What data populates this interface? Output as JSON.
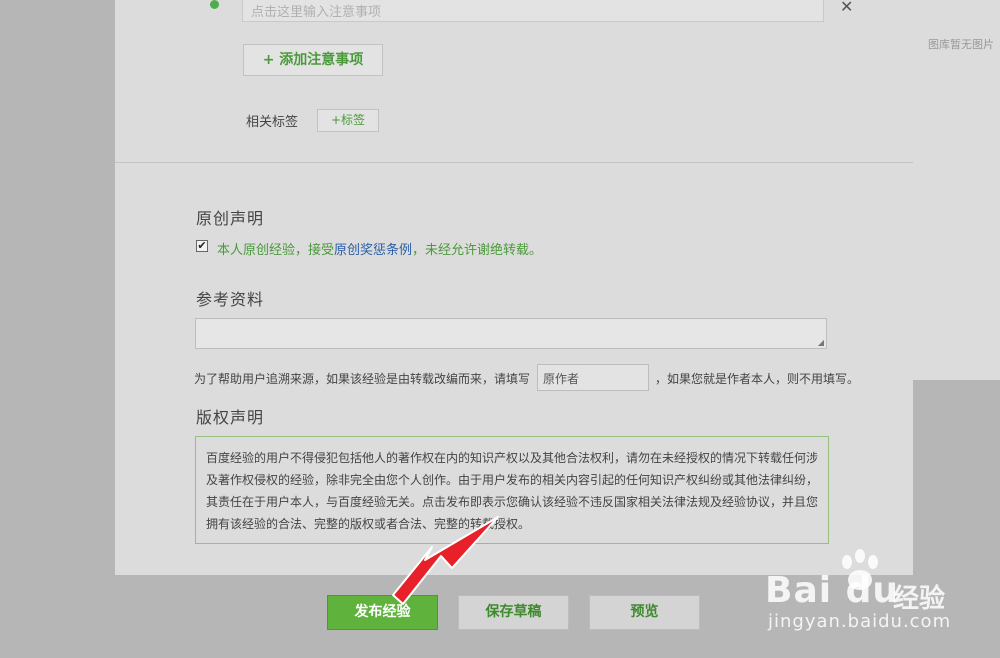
{
  "notes": {
    "input_placeholder": "点击这里输入注意事项",
    "close_glyph": "✕",
    "add_button": "+ 添加注意事项"
  },
  "tags": {
    "label": "相关标签",
    "add_button": "+标签"
  },
  "sidebar": {
    "empty_text": "图库暂无图片"
  },
  "original": {
    "title": "原创声明",
    "checked": true,
    "check_glyph": "✔",
    "text_before": "本人原创经验，接受",
    "link_text": "原创奖惩条例",
    "text_after": "，未经允许谢绝转载。"
  },
  "reference": {
    "title": "参考资料",
    "hint_before": "为了帮助用户追溯来源，如果该经验是由转载改编而来，请填写",
    "author_placeholder": "原作者",
    "hint_after": "，如果您就是作者本人，则不用填写。"
  },
  "copyright": {
    "title": "版权声明",
    "text": "百度经验的用户不得侵犯包括他人的著作权在内的知识产权以及其他合法权利，请勿在未经授权的情况下转载任何涉及著作权侵权的经验，除非完全由您个人创作。由于用户发布的相关内容引起的任何知识产权纠纷或其他法律纠纷，其责任在于用户本人，与百度经验无关。点击发布即表示您确认该经验不违反国家相关法律法规及经验协议，并且您拥有该经验的合法、完整的版权或者合法、完整的转载授权。"
  },
  "actions": {
    "publish": "发布经验",
    "save_draft": "保存草稿",
    "preview": "预览"
  },
  "watermark": {
    "logo": "Bai du",
    "chinese": "经验",
    "url": "jingyan.baidu.com"
  },
  "colors": {
    "accent_green": "#5fb33c",
    "link_blue": "#2a5ea8",
    "arrow_red": "#e8202a"
  }
}
